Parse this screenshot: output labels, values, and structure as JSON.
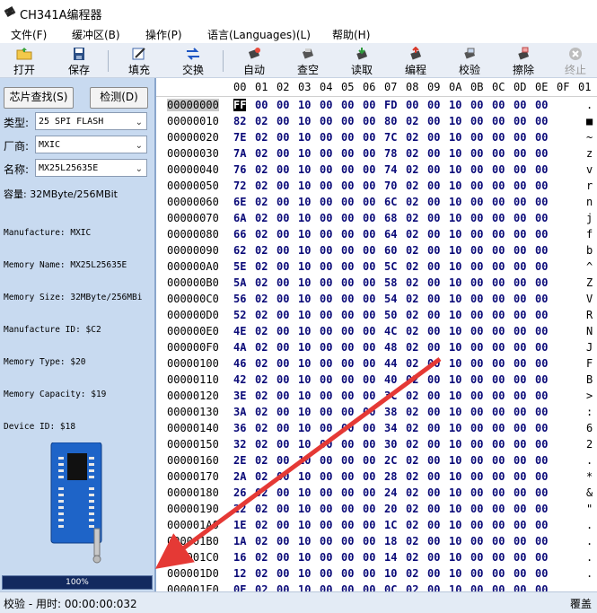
{
  "window": {
    "title": "CH341A编程器"
  },
  "menu": [
    "文件(F)",
    "缓冲区(B)",
    "操作(P)",
    "语言(Languages)(L)",
    "帮助(H)"
  ],
  "toolbar": {
    "open": "打开",
    "save": "保存",
    "fill": "填充",
    "swap": "交换",
    "auto": "自动",
    "blank": "查空",
    "read": "读取",
    "program": "编程",
    "verify": "校验",
    "erase": "擦除",
    "stop": "终止"
  },
  "left": {
    "find_chip": "芯片查找(S)",
    "detect": "检测(D)",
    "type_label": "类型:",
    "type_value": "25 SPI FLASH",
    "vendor_label": "厂商:",
    "vendor_value": "MXIC",
    "name_label": "名称:",
    "name_value": "MX25L25635E",
    "capacity": "容量: 32MByte/256MBit",
    "info_lines": [
      "Manufacture: MXIC",
      "Memory Name: MX25L25635E",
      "Memory Size: 32MByte/256MBi",
      "Manufacture ID: $C2",
      "Memory Type: $20",
      "Memory Capacity: $19",
      "Device ID: $18"
    ],
    "progress_text": "100%",
    "progress_value": 1.0
  },
  "hex": {
    "columns": [
      "00",
      "01",
      "02",
      "03",
      "04",
      "05",
      "06",
      "07",
      "08",
      "09",
      "0A",
      "0B",
      "0C",
      "0D",
      "0E",
      "0F",
      "01"
    ],
    "rows": [
      {
        "addr": "00000000",
        "bytes": [
          "FF",
          "00",
          "00",
          "10",
          "00",
          "00",
          "00",
          "FD",
          "00",
          "00",
          "10",
          "00",
          "00",
          "00",
          "00"
        ],
        "ascii": "."
      },
      {
        "addr": "00000010",
        "bytes": [
          "82",
          "02",
          "00",
          "10",
          "00",
          "00",
          "00",
          "80",
          "02",
          "00",
          "10",
          "00",
          "00",
          "00",
          "00"
        ],
        "ascii": "■"
      },
      {
        "addr": "00000020",
        "bytes": [
          "7E",
          "02",
          "00",
          "10",
          "00",
          "00",
          "00",
          "7C",
          "02",
          "00",
          "10",
          "00",
          "00",
          "00",
          "00"
        ],
        "ascii": "~"
      },
      {
        "addr": "00000030",
        "bytes": [
          "7A",
          "02",
          "00",
          "10",
          "00",
          "00",
          "00",
          "78",
          "02",
          "00",
          "10",
          "00",
          "00",
          "00",
          "00"
        ],
        "ascii": "z"
      },
      {
        "addr": "00000040",
        "bytes": [
          "76",
          "02",
          "00",
          "10",
          "00",
          "00",
          "00",
          "74",
          "02",
          "00",
          "10",
          "00",
          "00",
          "00",
          "00"
        ],
        "ascii": "v"
      },
      {
        "addr": "00000050",
        "bytes": [
          "72",
          "02",
          "00",
          "10",
          "00",
          "00",
          "00",
          "70",
          "02",
          "00",
          "10",
          "00",
          "00",
          "00",
          "00"
        ],
        "ascii": "r"
      },
      {
        "addr": "00000060",
        "bytes": [
          "6E",
          "02",
          "00",
          "10",
          "00",
          "00",
          "00",
          "6C",
          "02",
          "00",
          "10",
          "00",
          "00",
          "00",
          "00"
        ],
        "ascii": "n"
      },
      {
        "addr": "00000070",
        "bytes": [
          "6A",
          "02",
          "00",
          "10",
          "00",
          "00",
          "00",
          "68",
          "02",
          "00",
          "10",
          "00",
          "00",
          "00",
          "00"
        ],
        "ascii": "j"
      },
      {
        "addr": "00000080",
        "bytes": [
          "66",
          "02",
          "00",
          "10",
          "00",
          "00",
          "00",
          "64",
          "02",
          "00",
          "10",
          "00",
          "00",
          "00",
          "00"
        ],
        "ascii": "f"
      },
      {
        "addr": "00000090",
        "bytes": [
          "62",
          "02",
          "00",
          "10",
          "00",
          "00",
          "00",
          "60",
          "02",
          "00",
          "10",
          "00",
          "00",
          "00",
          "00"
        ],
        "ascii": "b"
      },
      {
        "addr": "000000A0",
        "bytes": [
          "5E",
          "02",
          "00",
          "10",
          "00",
          "00",
          "00",
          "5C",
          "02",
          "00",
          "10",
          "00",
          "00",
          "00",
          "00"
        ],
        "ascii": "^"
      },
      {
        "addr": "000000B0",
        "bytes": [
          "5A",
          "02",
          "00",
          "10",
          "00",
          "00",
          "00",
          "58",
          "02",
          "00",
          "10",
          "00",
          "00",
          "00",
          "00"
        ],
        "ascii": "Z"
      },
      {
        "addr": "000000C0",
        "bytes": [
          "56",
          "02",
          "00",
          "10",
          "00",
          "00",
          "00",
          "54",
          "02",
          "00",
          "10",
          "00",
          "00",
          "00",
          "00"
        ],
        "ascii": "V"
      },
      {
        "addr": "000000D0",
        "bytes": [
          "52",
          "02",
          "00",
          "10",
          "00",
          "00",
          "00",
          "50",
          "02",
          "00",
          "10",
          "00",
          "00",
          "00",
          "00"
        ],
        "ascii": "R"
      },
      {
        "addr": "000000E0",
        "bytes": [
          "4E",
          "02",
          "00",
          "10",
          "00",
          "00",
          "00",
          "4C",
          "02",
          "00",
          "10",
          "00",
          "00",
          "00",
          "00"
        ],
        "ascii": "N"
      },
      {
        "addr": "000000F0",
        "bytes": [
          "4A",
          "02",
          "00",
          "10",
          "00",
          "00",
          "00",
          "48",
          "02",
          "00",
          "10",
          "00",
          "00",
          "00",
          "00"
        ],
        "ascii": "J"
      },
      {
        "addr": "00000100",
        "bytes": [
          "46",
          "02",
          "00",
          "10",
          "00",
          "00",
          "00",
          "44",
          "02",
          "00",
          "10",
          "00",
          "00",
          "00",
          "00"
        ],
        "ascii": "F"
      },
      {
        "addr": "00000110",
        "bytes": [
          "42",
          "02",
          "00",
          "10",
          "00",
          "00",
          "00",
          "40",
          "02",
          "00",
          "10",
          "00",
          "00",
          "00",
          "00"
        ],
        "ascii": "B"
      },
      {
        "addr": "00000120",
        "bytes": [
          "3E",
          "02",
          "00",
          "10",
          "00",
          "00",
          "00",
          "3C",
          "02",
          "00",
          "10",
          "00",
          "00",
          "00",
          "00"
        ],
        "ascii": ">"
      },
      {
        "addr": "00000130",
        "bytes": [
          "3A",
          "02",
          "00",
          "10",
          "00",
          "00",
          "00",
          "38",
          "02",
          "00",
          "10",
          "00",
          "00",
          "00",
          "00"
        ],
        "ascii": ":"
      },
      {
        "addr": "00000140",
        "bytes": [
          "36",
          "02",
          "00",
          "10",
          "00",
          "00",
          "00",
          "34",
          "02",
          "00",
          "10",
          "00",
          "00",
          "00",
          "00"
        ],
        "ascii": "6"
      },
      {
        "addr": "00000150",
        "bytes": [
          "32",
          "02",
          "00",
          "10",
          "00",
          "00",
          "00",
          "30",
          "02",
          "00",
          "10",
          "00",
          "00",
          "00",
          "00"
        ],
        "ascii": "2"
      },
      {
        "addr": "00000160",
        "bytes": [
          "2E",
          "02",
          "00",
          "10",
          "00",
          "00",
          "00",
          "2C",
          "02",
          "00",
          "10",
          "00",
          "00",
          "00",
          "00"
        ],
        "ascii": "."
      },
      {
        "addr": "00000170",
        "bytes": [
          "2A",
          "02",
          "00",
          "10",
          "00",
          "00",
          "00",
          "28",
          "02",
          "00",
          "10",
          "00",
          "00",
          "00",
          "00"
        ],
        "ascii": "*"
      },
      {
        "addr": "00000180",
        "bytes": [
          "26",
          "02",
          "00",
          "10",
          "00",
          "00",
          "00",
          "24",
          "02",
          "00",
          "10",
          "00",
          "00",
          "00",
          "00"
        ],
        "ascii": "&"
      },
      {
        "addr": "00000190",
        "bytes": [
          "22",
          "02",
          "00",
          "10",
          "00",
          "00",
          "00",
          "20",
          "02",
          "00",
          "10",
          "00",
          "00",
          "00",
          "00"
        ],
        "ascii": "\""
      },
      {
        "addr": "000001A0",
        "bytes": [
          "1E",
          "02",
          "00",
          "10",
          "00",
          "00",
          "00",
          "1C",
          "02",
          "00",
          "10",
          "00",
          "00",
          "00",
          "00"
        ],
        "ascii": "."
      },
      {
        "addr": "000001B0",
        "bytes": [
          "1A",
          "02",
          "00",
          "10",
          "00",
          "00",
          "00",
          "18",
          "02",
          "00",
          "10",
          "00",
          "00",
          "00",
          "00"
        ],
        "ascii": "."
      },
      {
        "addr": "000001C0",
        "bytes": [
          "16",
          "02",
          "00",
          "10",
          "00",
          "00",
          "00",
          "14",
          "02",
          "00",
          "10",
          "00",
          "00",
          "00",
          "00"
        ],
        "ascii": "."
      },
      {
        "addr": "000001D0",
        "bytes": [
          "12",
          "02",
          "00",
          "10",
          "00",
          "00",
          "00",
          "10",
          "02",
          "00",
          "10",
          "00",
          "00",
          "00",
          "00"
        ],
        "ascii": "."
      },
      {
        "addr": "000001E0",
        "bytes": [
          "0E",
          "02",
          "00",
          "10",
          "00",
          "00",
          "00",
          "0C",
          "02",
          "00",
          "10",
          "00",
          "00",
          "00",
          "00"
        ],
        "ascii": "."
      }
    ]
  },
  "status": {
    "left": "校验 - 用时: 00:00:00:032",
    "right": "覆盖"
  },
  "colors": {
    "accent": "#e53935",
    "byte": "#0a0a78",
    "panel": "#c8daf0",
    "progress": "#0d1f56"
  }
}
